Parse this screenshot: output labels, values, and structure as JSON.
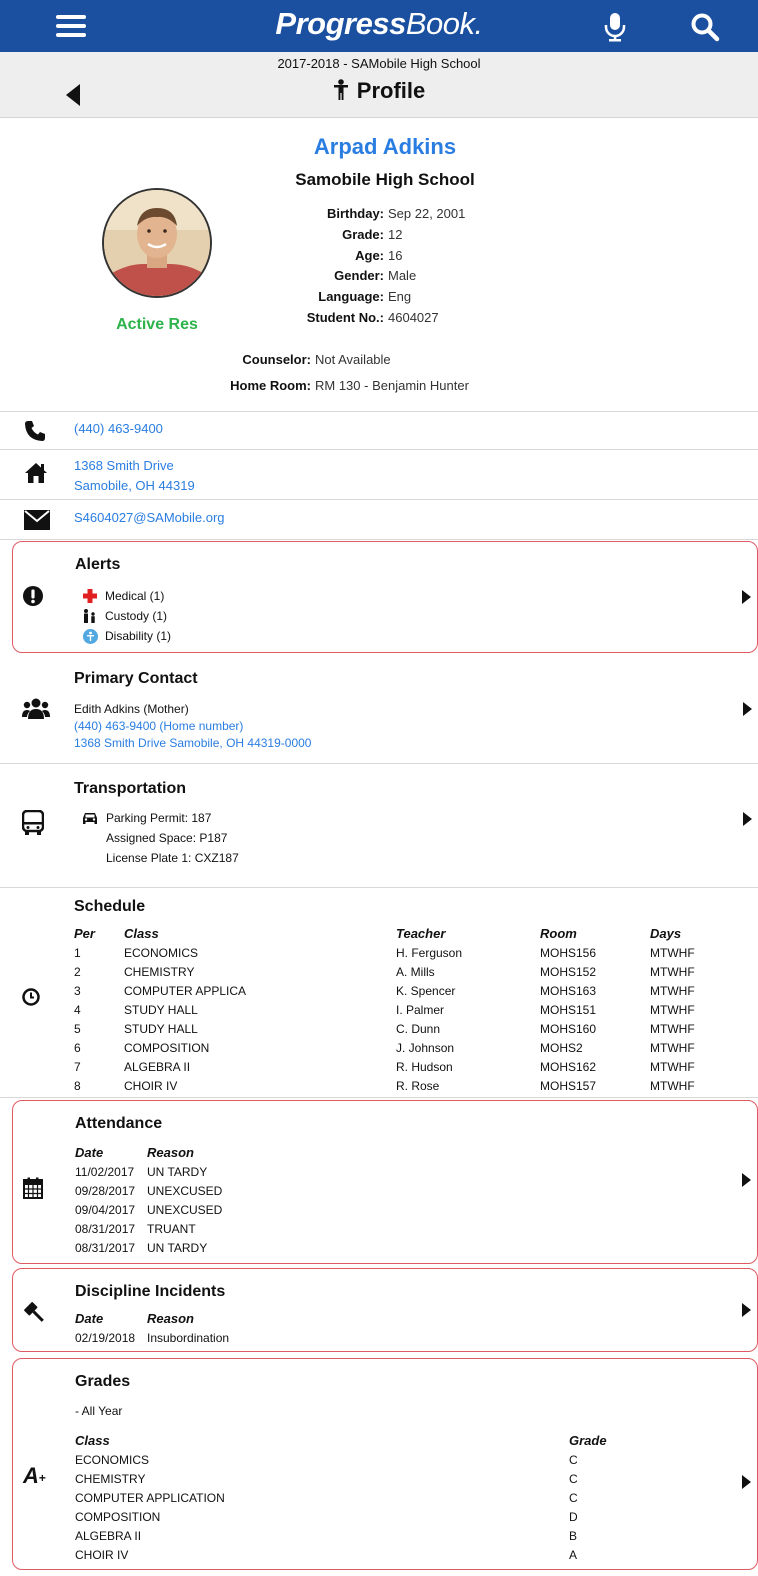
{
  "topbar": {
    "logo_bold": "Progress",
    "logo_light": "Book."
  },
  "subbar": {
    "year_school": "2017-2018 - SAMobile High School",
    "page_title": "Profile"
  },
  "student": {
    "name": "Arpad Adkins",
    "school": "Samobile High School",
    "status": "Active Res",
    "details": [
      {
        "label": "Birthday:",
        "value": "Sep 22, 2001"
      },
      {
        "label": "Grade:",
        "value": "12"
      },
      {
        "label": "Age:",
        "value": "16"
      },
      {
        "label": "Gender:",
        "value": "Male"
      },
      {
        "label": "Language:",
        "value": "Eng"
      },
      {
        "label": "Student No.:",
        "value": "4604027"
      }
    ],
    "counselor_label": "Counselor:",
    "counselor_value": "Not Available",
    "homeroom_label": "Home Room:",
    "homeroom_value": "RM 130 - Benjamin Hunter"
  },
  "contact": {
    "phone": "(440) 463-9400",
    "address_line1": "1368 Smith Drive",
    "address_line2": "Samobile, OH 44319",
    "email": "S4604027@SAMobile.org"
  },
  "alerts": {
    "title": "Alerts",
    "items": [
      "Medical (1)",
      "Custody (1)",
      "Disability (1)"
    ]
  },
  "primary_contact": {
    "title": "Primary Contact",
    "name": "Edith Adkins (Mother)",
    "phone": "(440) 463-9400 (Home number)",
    "address": "1368 Smith Drive  Samobile, OH 44319-0000"
  },
  "transportation": {
    "title": "Transportation",
    "permit": "Parking Permit: 187",
    "space": "Assigned Space: P187",
    "plate": "License Plate 1: CXZ187"
  },
  "schedule": {
    "title": "Schedule",
    "headers": {
      "per": "Per",
      "class": "Class",
      "teacher": "Teacher",
      "room": "Room",
      "days": "Days"
    },
    "rows": [
      {
        "per": "1",
        "class": "ECONOMICS",
        "teacher": "H. Ferguson",
        "room": "MOHS156",
        "days": "MTWHF"
      },
      {
        "per": "2",
        "class": "CHEMISTRY",
        "teacher": "A. Mills",
        "room": "MOHS152",
        "days": "MTWHF"
      },
      {
        "per": "3",
        "class": "COMPUTER APPLICA",
        "teacher": "K. Spencer",
        "room": "MOHS163",
        "days": "MTWHF"
      },
      {
        "per": "4",
        "class": "STUDY HALL",
        "teacher": "I. Palmer",
        "room": "MOHS151",
        "days": "MTWHF"
      },
      {
        "per": "5",
        "class": "STUDY HALL",
        "teacher": "C. Dunn",
        "room": "MOHS160",
        "days": "MTWHF"
      },
      {
        "per": "6",
        "class": "COMPOSITION",
        "teacher": "J. Johnson",
        "room": "MOHS2",
        "days": "MTWHF"
      },
      {
        "per": "7",
        "class": "ALGEBRA II",
        "teacher": "R. Hudson",
        "room": "MOHS162",
        "days": "MTWHF"
      },
      {
        "per": "8",
        "class": "CHOIR IV",
        "teacher": "R. Rose",
        "room": "MOHS157",
        "days": "MTWHF"
      }
    ]
  },
  "attendance": {
    "title": "Attendance",
    "headers": {
      "date": "Date",
      "reason": "Reason"
    },
    "rows": [
      {
        "date": "11/02/2017",
        "reason": "UN TARDY"
      },
      {
        "date": "09/28/2017",
        "reason": "UNEXCUSED"
      },
      {
        "date": "09/04/2017",
        "reason": "UNEXCUSED"
      },
      {
        "date": "08/31/2017",
        "reason": "TRUANT"
      },
      {
        "date": "08/31/2017",
        "reason": "UN TARDY"
      }
    ]
  },
  "discipline": {
    "title": "Discipline Incidents",
    "headers": {
      "date": "Date",
      "reason": "Reason"
    },
    "rows": [
      {
        "date": "02/19/2018",
        "reason": "Insubordination"
      }
    ]
  },
  "grades": {
    "title": "Grades",
    "period": "- All Year",
    "headers": {
      "class": "Class",
      "grade": "Grade"
    },
    "rows": [
      {
        "class": "ECONOMICS",
        "grade": "C"
      },
      {
        "class": "CHEMISTRY",
        "grade": "C"
      },
      {
        "class": "COMPUTER APPLICATION",
        "grade": "C"
      },
      {
        "class": "COMPOSITION",
        "grade": "D"
      },
      {
        "class": "ALGEBRA II",
        "grade": "B"
      },
      {
        "class": "CHOIR IV",
        "grade": "A"
      }
    ]
  }
}
